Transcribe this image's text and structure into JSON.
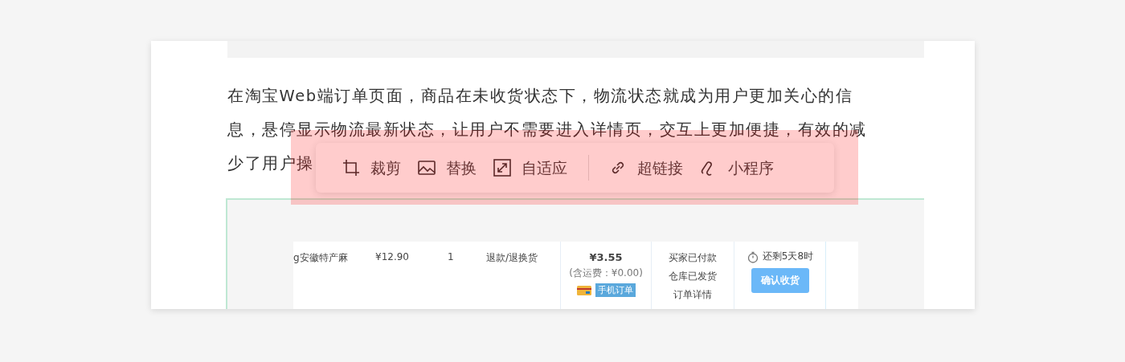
{
  "article": {
    "lines": [
      "在淘宝Web端订单页面，商品在未收货状态下，物流状态就成为用户更加关心的信",
      "息，悬停显示物流最新状态，让用户不需要进入详情页，交互上更加便捷，有效的减",
      "少了用户操"
    ]
  },
  "toolbar": {
    "groups": [
      [
        "裁剪",
        "替换",
        "自适应"
      ],
      [
        "超链接",
        "小程序"
      ]
    ]
  },
  "order_row": {
    "product": "g安徽特产麻",
    "price": "¥12.90",
    "quantity": "1",
    "service": "退款/退换货",
    "total": "¥3.55",
    "shipping": "(含运费：¥0.00)",
    "order_badge": "手机订单",
    "status": [
      "买家已付款",
      "仓库已发货",
      "订单详情"
    ],
    "countdown": "还剩5天8时",
    "confirm_button": "确认收货"
  }
}
